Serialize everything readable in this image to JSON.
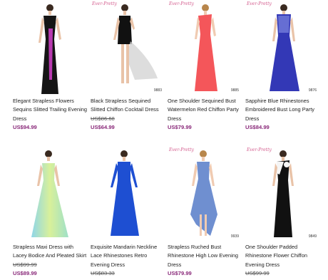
{
  "products": [
    {
      "name": "Elegant Strapless Flowers Sequins Slitted Trailing Evening Dress",
      "price": "US$94.99",
      "price_struck": false,
      "brand": "",
      "sku": "",
      "dress_color": "#151515",
      "accent_color": "#b83ab0"
    },
    {
      "name": "Black Strapless Sequined Slitted Chiffon Cocktail Dress",
      "price": "US$86.68",
      "price_struck": true,
      "price2": "US$64.99",
      "brand": "Ever-Pretty",
      "sku": "9883",
      "dress_color": "#111111",
      "accent_color": "#e6e6e6"
    },
    {
      "name": "One Shoulder Sequined Bust Watermelon Red Chiffon Party Dress",
      "price": "US$79.99",
      "price_struck": false,
      "brand": "Ever-Pretty",
      "sku": "9885",
      "dress_color": "#f4565a",
      "accent_color": "#f4565a"
    },
    {
      "name": "Sapphire Blue Rhinestones Embroidered Bust Long Party Dress",
      "price": "US$84.99",
      "price_struck": false,
      "brand": "Ever-Pretty",
      "sku": "9876",
      "dress_color": "#3338b6",
      "accent_color": "#7c86e0"
    },
    {
      "name": "Strapless Maxi Dress with Lacey Bodice And Pleated Skirt",
      "price": "US$99.99",
      "price_struck": true,
      "price2": "US$89.99",
      "brand": "",
      "sku": "",
      "dress_color": "#bfe98e",
      "accent_color": "#8fd6e8"
    },
    {
      "name": "Exquisite Mandarin Neckline Lace Rhinestones Retro Evening Dress",
      "price": "US$83.33",
      "price_struck": true,
      "brand": "",
      "sku": "",
      "dress_color": "#1e4fd2",
      "accent_color": "#1e4fd2"
    },
    {
      "name": "Strapless Ruched Bust Rhinestone High Low Evening Dress",
      "price": "US$79.99",
      "price_struck": false,
      "brand": "Ever-Pretty",
      "sku": "9939",
      "dress_color": "#6f8fd0",
      "accent_color": "#9bb7ea"
    },
    {
      "name": "One Shoulder Padded Rhinestone Flower Chiffon Evening Dress",
      "price": "US$99.99",
      "price_struck": true,
      "brand": "Ever-Pretty",
      "sku": "9849",
      "dress_color": "#111111",
      "accent_color": "#f5f5f5"
    }
  ]
}
